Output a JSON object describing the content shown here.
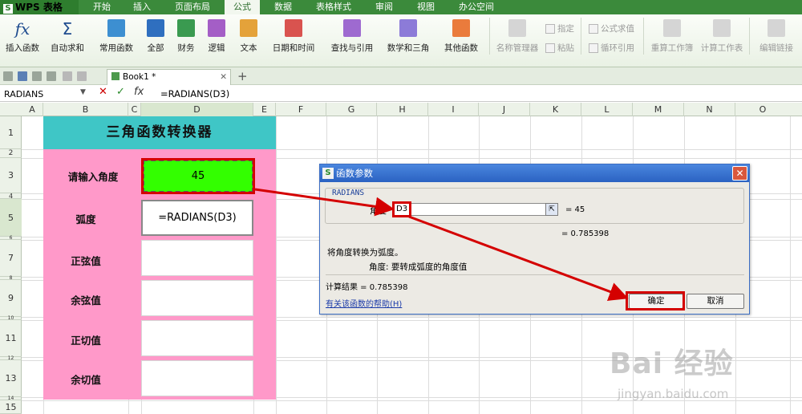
{
  "app": {
    "logo": "WPS 表格",
    "logo_mark": "S"
  },
  "menu": [
    "开始",
    "插入",
    "页面布局",
    "公式",
    "数据",
    "表格样式",
    "审阅",
    "视图",
    "办公空间"
  ],
  "menu_active": "公式",
  "ribbon": {
    "insert_fn": "插入函数",
    "autosum": "自动求和",
    "common": "常用函数",
    "all": "全部",
    "finance": "财务",
    "logic": "逻辑",
    "text": "文本",
    "datetime": "日期和时间",
    "lookup": "查找与引用",
    "math": "数学和三角",
    "other": "其他函数",
    "name_mgr": "名称管理器",
    "specify": "指定",
    "paste": "粘贴",
    "eval": "公式求值",
    "circular": "循环引用",
    "recalc_book": "重算工作簿",
    "calc_sheet": "计算工作表",
    "edit_links": "编辑链接",
    "fx_symbol": "fx",
    "sigma_symbol": "Σ"
  },
  "tab": {
    "name": "Book1 *"
  },
  "formula_bar": {
    "name_box": "RADIANS",
    "cancel": "✕",
    "confirm": "✓",
    "fx": "fx",
    "content": "=RADIANS(D3)"
  },
  "columns": [
    "A",
    "B",
    "C",
    "D",
    "E",
    "F",
    "G",
    "H",
    "I",
    "J",
    "K",
    "L",
    "M",
    "N",
    "O"
  ],
  "rows": [
    "1",
    "2",
    "3",
    "4",
    "5",
    "6",
    "7",
    "8",
    "9",
    "10",
    "11",
    "12",
    "13",
    "14",
    "15"
  ],
  "sheet": {
    "title": "三角函数转换器",
    "labels": {
      "angle": "请输入角度",
      "radian": "弧度",
      "sin": "正弦值",
      "cos": "余弦值",
      "tan": "正切值",
      "cot": "余切值"
    },
    "angle_value": "45",
    "radian_formula": "=RADIANS(D3)"
  },
  "dialog": {
    "title": "函数参数",
    "logo_mark": "S",
    "close": "✕",
    "function_name": "RADIANS",
    "arg_label": "角度",
    "arg_value": "D3",
    "arg_result": "= 45",
    "result_top": "= 0.785398",
    "description": "将角度转换为弧度。",
    "arg_description": "角度:  要转成弧度的角度值",
    "calc_result": "计算结果 = 0.785398",
    "help_link": "有关该函数的帮助(H)",
    "ok": "确定",
    "cancel": "取消"
  },
  "watermark": {
    "text": "Bai 经验",
    "url": "jingyan.baidu.com"
  },
  "colors": {
    "menu_green": "#3b8a3b",
    "title_teal": "#3fc6c6",
    "panel_pink": "#ff99c9",
    "input_green": "#33ff00",
    "annotation_red": "#d40000",
    "dialog_blue": "#2b62c2"
  }
}
